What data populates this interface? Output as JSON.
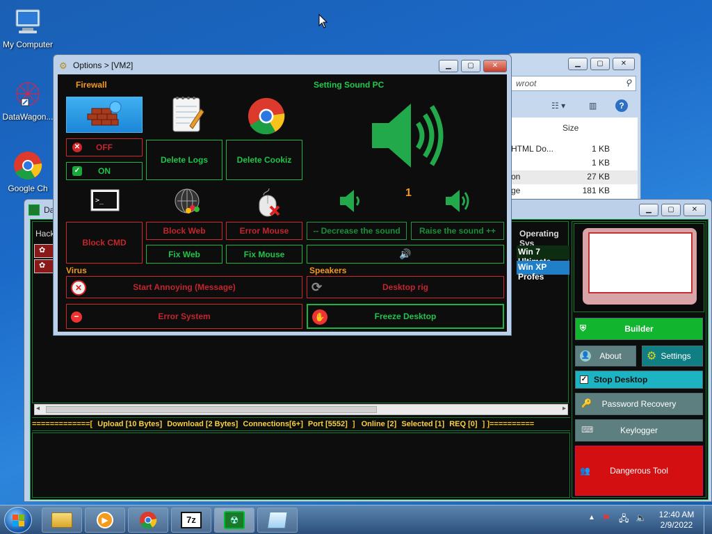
{
  "desktop": {
    "icons": [
      {
        "label": "My Computer"
      },
      {
        "label": "DataWagon..."
      },
      {
        "label": "Google Ch"
      }
    ]
  },
  "explorer": {
    "search_placeholder": "wroot",
    "size_header": "Size",
    "rows": [
      {
        "name": "HTML Do...",
        "size": "1 KB"
      },
      {
        "name": "",
        "size": "1 KB"
      },
      {
        "name": "on",
        "size": "27 KB"
      },
      {
        "name": "ge",
        "size": "181 KB"
      }
    ]
  },
  "options_window": {
    "title": "Options > [VM2]",
    "firewall_title": "Firewall",
    "sound_title": "Setting Sound PC",
    "virus_title": "Virus",
    "speakers_title": "Speakers",
    "off_label": "OFF",
    "on_label": "ON",
    "delete_logs": "Delete Logs",
    "delete_cookiz": "Delete Cookiz",
    "block_cmd": "Block CMD",
    "block_web": "Block Web",
    "error_mouse": "Error Mouse",
    "fix_web": "Fix Web",
    "fix_mouse": "Fix Mouse",
    "sound_level": "1",
    "decrease_sound": "-- Decrease the sound",
    "raise_sound": "Raise the sound ++",
    "start_annoying": "Start Annoying (Message)",
    "desktop_rig": "Desktop rig",
    "error_system": "Error System",
    "freeze_desktop": "Freeze Desktop"
  },
  "main_window": {
    "title": "Da",
    "col_hack": "Hack",
    "col_os": "Operating Sys",
    "os_rows": [
      "Win 7 Ultimate",
      "Win XP Profes"
    ],
    "status_line": {
      "prefix": "=============[",
      "upload": "Upload [10 Bytes]",
      "download": "Download [2 Bytes]",
      "connections": "Connections[6+]",
      "port": "Port [5552]",
      "sep1": "]",
      "online": "Online [2]",
      "selected": "Selected [1]",
      "req": "REQ [0]",
      "suffix": "]  ]=========="
    },
    "builder": "Builder",
    "about": "About",
    "settings": "Settings",
    "stop_desktop": "Stop Desktop",
    "password_recovery": "Password Recovery",
    "keylogger": "Keylogger",
    "dangerous_tool": "Dangerous Tool"
  },
  "taskbar": {
    "time": "12:40 AM",
    "date": "2/9/2022",
    "apps": [
      "explorer",
      "media-player",
      "chrome",
      "7zip",
      "rat-tool",
      "notepad"
    ]
  }
}
